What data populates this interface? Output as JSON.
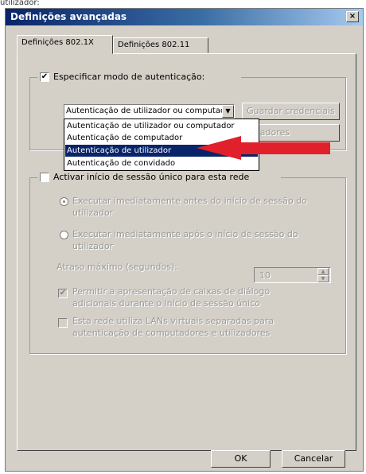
{
  "top_fragment": "utilizador:",
  "window": {
    "title": "Definições avançadas",
    "close_glyph": "×",
    "close_icon": "close-icon"
  },
  "tabs": [
    {
      "label": "Definições 802.1X",
      "active": true
    },
    {
      "label": "Definições 802.11",
      "active": false
    }
  ],
  "auth_group": {
    "specify_label": "Especificar modo de autenticação:",
    "specify_checked": true,
    "check_glyph": "✔",
    "selected_value": "Autenticação de utilizador ou computador",
    "dropdown_arrow": "▼",
    "save_credentials": "Guardar credenciais",
    "hidden_button_fragment": "adores",
    "options": [
      "Autenticação de utilizador ou computador",
      "Autenticação de computador",
      "Autenticação de utilizador",
      "Autenticação de convidado"
    ],
    "highlighted_option_index": 2,
    "arrow_color": "#e0202a"
  },
  "sso_group": {
    "enable_label": "Activar início de sessão único para esta rede",
    "enable_checked": false,
    "radio_before": "Executar imediatamente antes do início de sessão do utilizador",
    "radio_after": "Executar imediatamente após o início de sessão do utilizador",
    "max_delay_label": "Atraso máximo (segundos):",
    "max_delay_value": "10",
    "spin_up": "▲",
    "spin_down": "▼",
    "allow_dialogs": "Permitir a apresentação de caixas de diálogo adicionais durante o início de sessão único",
    "allow_dialogs_checked": true,
    "vlan_label": "Esta rede utiliza LANs virtuais separadas para autenticação de computadores e utilizadores",
    "vlan_checked": false
  },
  "buttons": {
    "ok": "OK",
    "cancel": "Cancelar"
  }
}
